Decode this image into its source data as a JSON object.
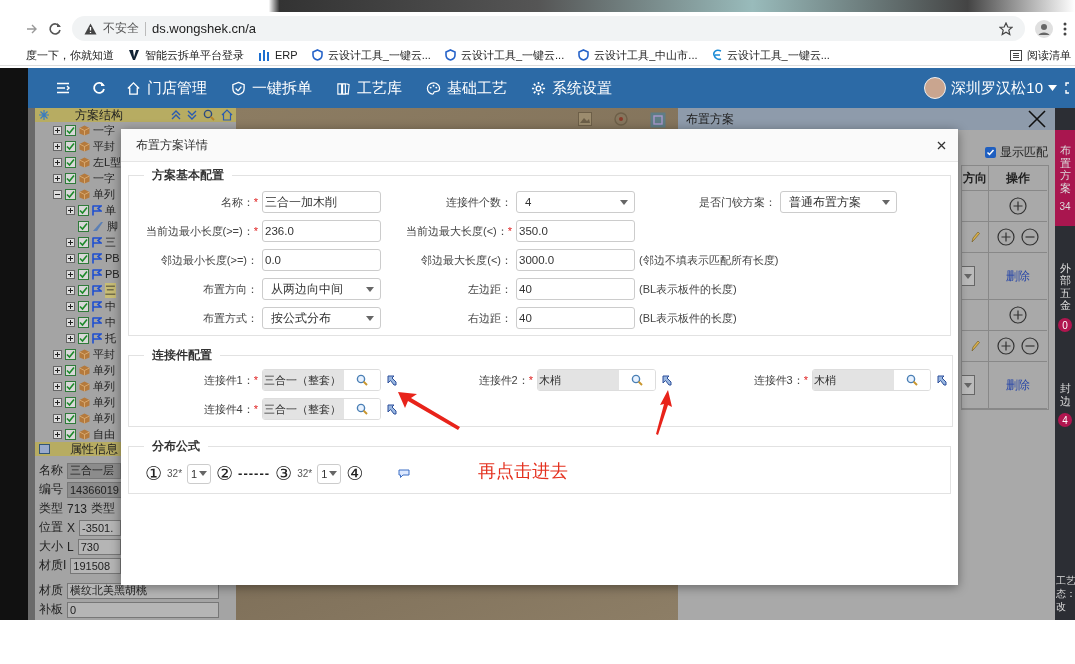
{
  "browser": {
    "security": "不安全",
    "url": "ds.wongshek.cn/a"
  },
  "bookmarks": [
    {
      "kind": "plain",
      "label": "度一下，你就知道"
    },
    {
      "kind": "logo",
      "label": "智能云拆单平台登录"
    },
    {
      "kind": "bars",
      "label": "ERP"
    },
    {
      "kind": "shield",
      "label": "云设计工具_一键云..."
    },
    {
      "kind": "shield",
      "label": "云设计工具_一键云..."
    },
    {
      "kind": "shield",
      "label": "云设计工具_中山市..."
    },
    {
      "kind": "e",
      "label": "云设计工具_一键云..."
    }
  ],
  "reading_list": "阅读清单",
  "nav": {
    "items": [
      {
        "label": "门店管理"
      },
      {
        "label": "一键拆单"
      },
      {
        "label": "工艺库"
      },
      {
        "label": "基础工艺"
      },
      {
        "label": "系统设置"
      }
    ],
    "user": "深圳罗汉松10"
  },
  "tree": {
    "title": "方案结构",
    "items": [
      {
        "kind": "group",
        "label": "一字",
        "expanded": false,
        "checked": true,
        "selected": false
      },
      {
        "kind": "group",
        "label": "平封",
        "expanded": false,
        "checked": true,
        "selected": false
      },
      {
        "kind": "group",
        "label": "左L型",
        "expanded": false,
        "checked": true,
        "selected": false
      },
      {
        "kind": "group",
        "label": "一字",
        "expanded": false,
        "checked": true,
        "selected": false
      },
      {
        "kind": "group",
        "label": "单列",
        "expanded": true,
        "checked": true,
        "selected": false,
        "children": [
          {
            "kind": "part",
            "label": "单",
            "expanded": false,
            "checked": true,
            "selected": false
          },
          {
            "kind": "leaf",
            "label": "脚",
            "checked": true,
            "selected": false
          },
          {
            "kind": "part",
            "label": "三",
            "expanded": false,
            "checked": true,
            "selected": false
          },
          {
            "kind": "part",
            "label": "PB",
            "expanded": false,
            "checked": true,
            "selected": false
          },
          {
            "kind": "part",
            "label": "PB",
            "expanded": false,
            "checked": true,
            "selected": false
          },
          {
            "kind": "part",
            "label": "三",
            "expanded": false,
            "checked": true,
            "selected": true
          },
          {
            "kind": "part",
            "label": "中",
            "expanded": false,
            "checked": true,
            "selected": false
          },
          {
            "kind": "part",
            "label": "中",
            "expanded": false,
            "checked": true,
            "selected": false
          },
          {
            "kind": "part",
            "label": "托",
            "expanded": false,
            "checked": true,
            "selected": false
          }
        ]
      },
      {
        "kind": "group",
        "label": "平封",
        "expanded": false,
        "checked": true,
        "selected": false
      },
      {
        "kind": "group",
        "label": "单列",
        "expanded": false,
        "checked": true,
        "selected": false
      },
      {
        "kind": "group",
        "label": "单列",
        "expanded": false,
        "checked": true,
        "selected": false
      },
      {
        "kind": "group",
        "label": "单列",
        "expanded": false,
        "checked": true,
        "selected": false
      },
      {
        "kind": "group",
        "label": "单列",
        "expanded": false,
        "checked": true,
        "selected": false
      },
      {
        "kind": "group",
        "label": "自由",
        "expanded": false,
        "checked": true,
        "selected": false
      }
    ]
  },
  "properties": {
    "title": "属性信息",
    "rows": [
      {
        "label": "名称",
        "parts": [
          {
            "kind": "readonly",
            "text": "三合一层"
          }
        ]
      },
      {
        "label": "编号",
        "parts": [
          {
            "kind": "readonly",
            "text": "14366019"
          }
        ]
      },
      {
        "label": "类型",
        "parts": [
          {
            "kind": "text",
            "text": "713"
          },
          {
            "kind": "text",
            "text": "类型"
          }
        ]
      },
      {
        "label": "位置",
        "parts": [
          {
            "kind": "text",
            "text": "X"
          },
          {
            "kind": "field",
            "text": "-3501."
          }
        ]
      },
      {
        "label": "大小",
        "parts": [
          {
            "kind": "text",
            "text": "L"
          },
          {
            "kind": "field",
            "text": "730"
          }
        ]
      },
      {
        "label": "材质I",
        "parts": [
          {
            "kind": "field",
            "text": "191508"
          }
        ]
      },
      {
        "label": "材质",
        "parts": [
          {
            "kind": "field",
            "text": "横纹北美黑胡桃"
          }
        ]
      },
      {
        "label": "补板",
        "parts": [
          {
            "kind": "field",
            "text": "0"
          }
        ]
      }
    ]
  },
  "layout_panel": {
    "title": "布置方案",
    "show_match": {
      "label": "显示匹配",
      "checked": true
    },
    "columns": [
      "方向",
      "操作"
    ],
    "rows": [
      {
        "kind": "add"
      },
      {
        "kind": "edit"
      },
      {
        "kind": "remove",
        "action": "删除"
      },
      {
        "kind": "add"
      },
      {
        "kind": "edit"
      },
      {
        "kind": "remove",
        "action": "删除"
      }
    ]
  },
  "side_tabs": [
    {
      "label": "布置方案",
      "count": "34",
      "selected": true
    },
    {
      "label": "外部五金",
      "count": "0",
      "selected": false
    },
    {
      "label": "封边",
      "count": "4",
      "selected": false
    }
  ],
  "side_footer": [
    "工艺",
    "态：",
    "改"
  ],
  "modal": {
    "title": "布置方案详情",
    "basic": {
      "title": "方案基本配置",
      "rows": [
        [
          {
            "label": "名称：",
            "required": "*",
            "kind": "input",
            "value": "三合一加木削"
          },
          {
            "label": "连接件个数：",
            "kind": "select",
            "value": "4"
          },
          {
            "label": "是否门铰方案：",
            "kind": "select",
            "value": "普通布置方案"
          }
        ],
        [
          {
            "label": "当前边最小长度(>=)：",
            "required": "*",
            "kind": "input",
            "value": "236.0"
          },
          {
            "label": "当前边最大长度(<)：",
            "required": "*",
            "kind": "input",
            "value": "350.0"
          }
        ],
        [
          {
            "label": "邻边最小长度(>=)：",
            "kind": "input",
            "value": "0.0"
          },
          {
            "label": "邻边最大长度(<)：",
            "kind": "input",
            "value": "3000.0",
            "note": "(邻边不填表示匹配所有长度)"
          }
        ],
        [
          {
            "label": "布置方向：",
            "kind": "select",
            "value": "从两边向中间"
          },
          {
            "label": "左边距：",
            "kind": "input",
            "value": "40",
            "note": "(BL表示板件的长度)"
          }
        ],
        [
          {
            "label": "布置方式：",
            "kind": "select",
            "value": "按公式分布"
          },
          {
            "label": "右边距：",
            "kind": "input",
            "value": "40",
            "note": "(BL表示板件的长度)"
          }
        ]
      ]
    },
    "connectors": {
      "title": "连接件配置",
      "items": [
        {
          "label": "连接件1：",
          "required": "*",
          "value": "三合一（整套）"
        },
        {
          "label": "连接件2：",
          "required": "*",
          "value": "木梢"
        },
        {
          "label": "连接件3：",
          "required": "*",
          "value": "木梢"
        },
        {
          "label": "连接件4：",
          "required": "*",
          "value": "三合一（整套）"
        }
      ]
    },
    "formula": {
      "title": "分布公式",
      "items": [
        {
          "kind": "circle",
          "text": "①"
        },
        {
          "kind": "text",
          "text": "32*"
        },
        {
          "kind": "select",
          "value": "1"
        },
        {
          "kind": "circle",
          "text": "②"
        },
        {
          "kind": "dash",
          "text": "------"
        },
        {
          "kind": "circle",
          "text": "③"
        },
        {
          "kind": "text",
          "text": "32*"
        },
        {
          "kind": "select",
          "value": "1"
        },
        {
          "kind": "circle",
          "text": "④"
        },
        {
          "kind": "comment"
        }
      ]
    }
  },
  "annotation": "再点击进去"
}
